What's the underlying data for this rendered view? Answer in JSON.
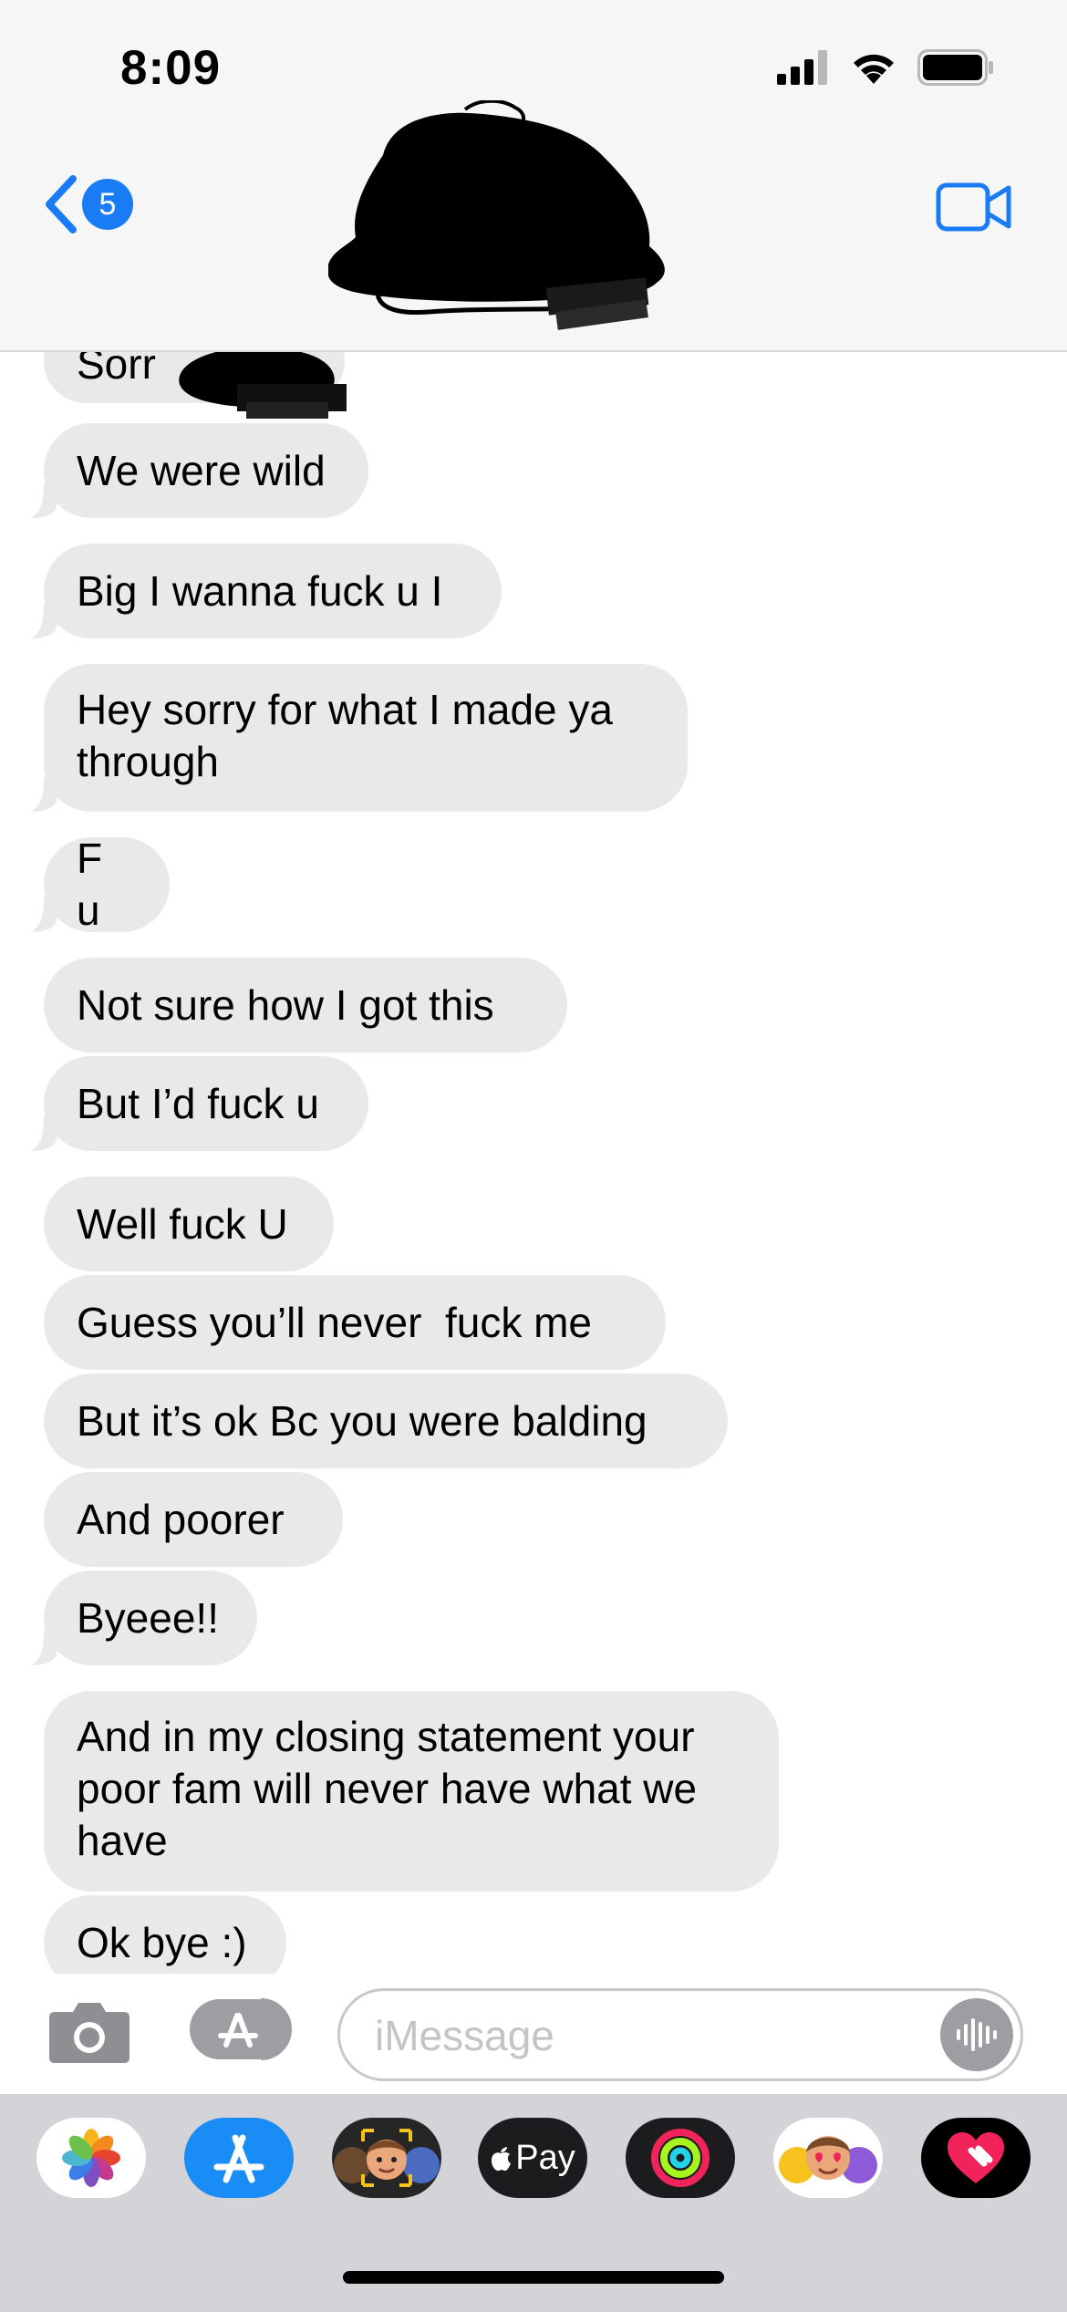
{
  "status_bar": {
    "time": "8:09"
  },
  "header": {
    "unread_count": "5",
    "accent_color": "#1a7cf5"
  },
  "messages": [
    {
      "text": "Sorr",
      "partially_redacted": true
    },
    {
      "text": "We were wild"
    },
    {
      "text": "Big I wanna fuck u I"
    },
    {
      "text": "Hey sorry for what I made ya",
      "text2": "through"
    },
    {
      "text": "F u"
    },
    {
      "text": "Not sure how I got this"
    },
    {
      "text": "But I’d fuck u"
    },
    {
      "text": "Well fuck U"
    },
    {
      "text": "Guess you’ll never  fuck me"
    },
    {
      "text": "But it’s ok Bc you were balding"
    },
    {
      "text": "And poorer"
    },
    {
      "text": "Byeee!!"
    },
    {
      "text": "And in my closing statement your",
      "text2": "poor fam will never have what we",
      "text3": "have"
    },
    {
      "text": "Ok bye :)"
    }
  ],
  "composer": {
    "placeholder": "iMessage"
  },
  "app_drawer": {
    "apps": [
      {
        "icon": "photos-icon"
      },
      {
        "icon": "app-store-icon"
      },
      {
        "icon": "memoji-stickers-icon"
      },
      {
        "icon": "apple-pay-icon",
        "label": "Pay"
      },
      {
        "icon": "activity-icon"
      },
      {
        "icon": "animoji-icon"
      },
      {
        "icon": "digital-touch-icon"
      }
    ]
  }
}
